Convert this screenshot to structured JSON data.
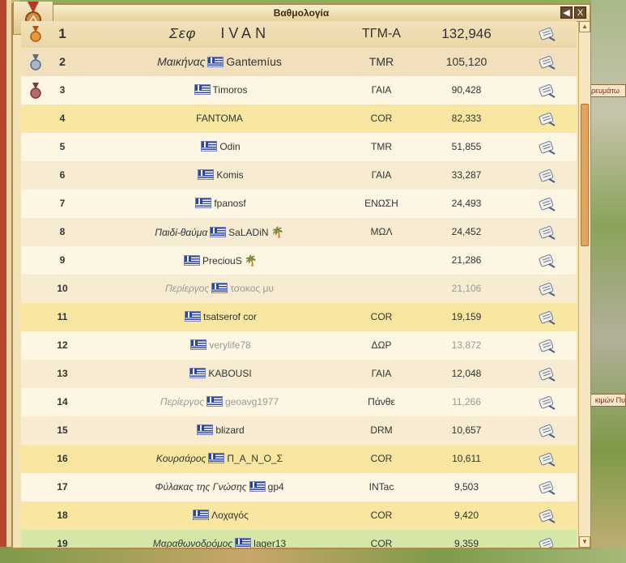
{
  "window": {
    "title": "Βαθμολογία",
    "back_icon": "arrow-left-icon",
    "close_label": "X"
  },
  "side_labels": {
    "top": "ρευμάτω",
    "bottom": "κιμών Πυ"
  },
  "colors": {
    "highlight": "#f9e7a1",
    "green": "#d4e7a6",
    "row_light": "#fdf6e3",
    "row_alt": "#f7ecd2"
  },
  "rows": [
    {
      "rank": "1",
      "title": "Σεφ",
      "name": "IVAN",
      "alliance": "ΤΓΜ-Α",
      "points": "132,946",
      "medal": "gold",
      "style": "top1",
      "flag": false
    },
    {
      "rank": "2",
      "title": "Μαικήνας",
      "name": "Gantemíus",
      "alliance": "TMR",
      "points": "105,120",
      "medal": "silver",
      "style": "top2",
      "flag": true
    },
    {
      "rank": "3",
      "title": "",
      "name": "Timoros",
      "alliance": "ΓΑΙΑ",
      "points": "90,428",
      "medal": "bronze",
      "style": "c0",
      "flag": true
    },
    {
      "rank": "4",
      "title": "",
      "name": "FANTOMA",
      "alliance": "COR",
      "points": "82,333",
      "style": "hl",
      "flag": false
    },
    {
      "rank": "5",
      "title": "",
      "name": "Odin",
      "alliance": "TMR",
      "points": "51,855",
      "style": "c0",
      "flag": true
    },
    {
      "rank": "6",
      "title": "",
      "name": "Komis",
      "alliance": "ΓΑΙΑ",
      "points": "33,287",
      "style": "c1",
      "flag": true
    },
    {
      "rank": "7",
      "title": "",
      "name": "fpanosf",
      "alliance": "ΕΝΩΣΗ",
      "points": "24,493",
      "style": "c0",
      "flag": true
    },
    {
      "rank": "8",
      "title": "Παιδί-θαύμα",
      "name": "SaLADiN",
      "alliance": "ΜΩΛ",
      "points": "24,452",
      "style": "c1",
      "flag": true,
      "palm": true
    },
    {
      "rank": "9",
      "title": "",
      "name": "PreciouS",
      "alliance": "",
      "points": "21,286",
      "style": "c0",
      "flag": true,
      "palm": true
    },
    {
      "rank": "10",
      "title": "Περίεργος",
      "name": "τσοκος μυ",
      "alliance": "",
      "points": "21,106",
      "style": "c1",
      "flag": true,
      "muted": true
    },
    {
      "rank": "11",
      "title": "",
      "name": "tsatserof cor",
      "alliance": "COR",
      "points": "19,159",
      "style": "hl",
      "flag": true
    },
    {
      "rank": "12",
      "title": "",
      "name": "verylife78",
      "alliance": "ΔΩΡ",
      "points": "13,872",
      "style": "c0",
      "flag": true,
      "muted": true
    },
    {
      "rank": "13",
      "title": "",
      "name": "KABOUSI",
      "alliance": "ΓΑΙΑ",
      "points": "12,048",
      "style": "c1",
      "flag": true
    },
    {
      "rank": "14",
      "title": "Περίεργος",
      "name": "geoavg1977",
      "alliance": "Πάνθε",
      "points": "11,266",
      "style": "c0",
      "flag": true,
      "muted": true
    },
    {
      "rank": "15",
      "title": "",
      "name": "blizard",
      "alliance": "DRM",
      "points": "10,657",
      "style": "c1",
      "flag": true
    },
    {
      "rank": "16",
      "title": "Κουρσάρος",
      "name": "Π_Α_Ν_Ο_Σ",
      "alliance": "COR",
      "points": "10,611",
      "style": "hl",
      "flag": true
    },
    {
      "rank": "17",
      "title": "Φύλακας της Γνώσης",
      "name": "gp4",
      "alliance": "INTac",
      "points": "9,503",
      "style": "c0",
      "flag": true
    },
    {
      "rank": "18",
      "title": "",
      "name": "Λοχαγός",
      "alliance": "COR",
      "points": "9,420",
      "style": "hl",
      "flag": true
    },
    {
      "rank": "19",
      "title": "Μαραθωνοδρόμος",
      "name": "lager13",
      "alliance": "COR",
      "points": "9,359",
      "style": "gr",
      "flag": true
    }
  ]
}
